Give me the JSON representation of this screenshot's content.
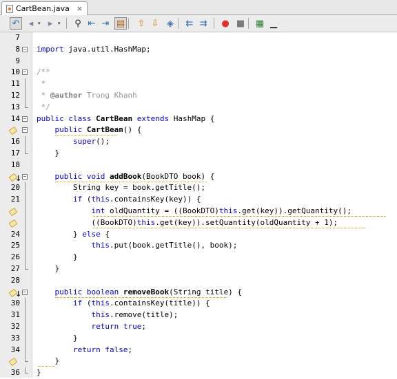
{
  "tab": {
    "title": "CartBean.java",
    "close": "×"
  },
  "toolbar": {
    "buttons": [
      {
        "name": "last-edit-button",
        "glyph": "↶",
        "color": "#3a6fb0"
      },
      {
        "name": "back-button",
        "glyph": "◂",
        "color": "#7b8796"
      },
      {
        "name": "forward-button",
        "glyph": "▸",
        "color": "#7b8796"
      },
      {
        "name": "find-button",
        "glyph": "⚲",
        "color": "#2a2a2a"
      },
      {
        "name": "find-previous-button",
        "glyph": "⇤",
        "color": "#2d6db0"
      },
      {
        "name": "find-next-button",
        "glyph": "⇥",
        "color": "#2d6db0"
      },
      {
        "name": "toggle-highlight-button",
        "glyph": "▤",
        "color": "#b06010"
      },
      {
        "name": "previous-bookmark-button",
        "glyph": "⇧",
        "color": "#d08a10"
      },
      {
        "name": "next-bookmark-button",
        "glyph": "⇩",
        "color": "#d08a10"
      },
      {
        "name": "toggle-bookmark-button",
        "glyph": "◈",
        "color": "#3c74b0"
      },
      {
        "name": "shift-left-button",
        "glyph": "⇇",
        "color": "#2d6db0"
      },
      {
        "name": "shift-right-button",
        "glyph": "⇉",
        "color": "#2d6db0"
      },
      {
        "name": "record-macro-button",
        "glyph": "●",
        "color": "#e0322b"
      },
      {
        "name": "stop-macro-button",
        "glyph": "■",
        "color": "#7a7a7a"
      },
      {
        "name": "diff-button",
        "glyph": "▦",
        "color": "#2f7d2f"
      },
      {
        "name": "comment-button",
        "glyph": "▁",
        "color": "#333333"
      }
    ]
  },
  "lines": [
    {
      "num": "7",
      "code": ""
    },
    {
      "num": "8",
      "code": "import java.util.HashMap;"
    },
    {
      "num": "9",
      "code": ""
    },
    {
      "num": "10",
      "code": "/**"
    },
    {
      "num": "11",
      "code": " *"
    },
    {
      "num": "12",
      "code": " * @author Trong Khanh"
    },
    {
      "num": "13",
      "code": " */"
    },
    {
      "num": "14",
      "code": "public class CartBean extends HashMap {"
    },
    {
      "num": "",
      "code": "    public CartBean() {"
    },
    {
      "num": "16",
      "code": "        super();"
    },
    {
      "num": "17",
      "code": "    }"
    },
    {
      "num": "18",
      "code": ""
    },
    {
      "num": "",
      "code": "    public void addBook(BookDTO book) {"
    },
    {
      "num": "20",
      "code": "        String key = book.getTitle();"
    },
    {
      "num": "21",
      "code": "        if (this.containsKey(key)) {"
    },
    {
      "num": "",
      "code": "            int oldQuantity = ((BookDTO)this.get(key)).getQuantity();"
    },
    {
      "num": "",
      "code": "            ((BookDTO)this.get(key)).setQuantity(oldQuantity + 1);"
    },
    {
      "num": "24",
      "code": "        } else {"
    },
    {
      "num": "25",
      "code": "            this.put(book.getTitle(), book);"
    },
    {
      "num": "26",
      "code": "        }"
    },
    {
      "num": "27",
      "code": "    }"
    },
    {
      "num": "28",
      "code": ""
    },
    {
      "num": "",
      "code": "    public boolean removeBook(String title) {"
    },
    {
      "num": "30",
      "code": "        if (this.containsKey(title)) {"
    },
    {
      "num": "31",
      "code": "            this.remove(title);"
    },
    {
      "num": "32",
      "code": "            return true;"
    },
    {
      "num": "33",
      "code": "        }"
    },
    {
      "num": "34",
      "code": "        return false;"
    },
    {
      "num": "",
      "code": "    }"
    },
    {
      "num": "36",
      "code": "}"
    }
  ],
  "colors": {
    "keyword": "#0000e6",
    "comment": "#969696",
    "gutter": "#ececec"
  }
}
